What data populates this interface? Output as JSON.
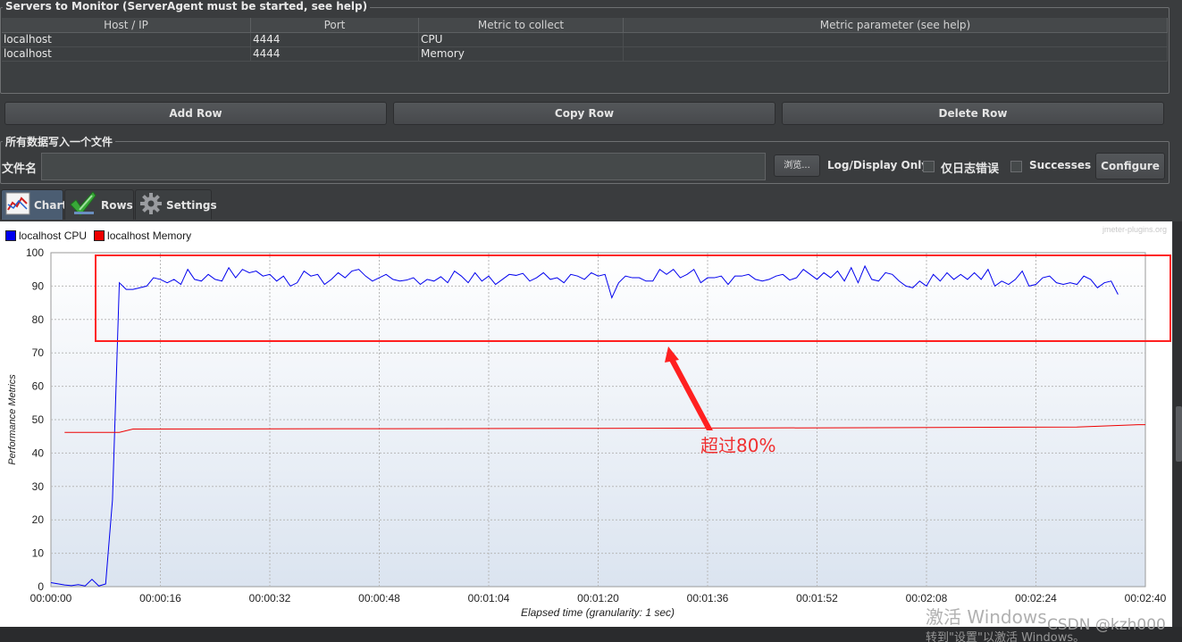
{
  "servers": {
    "title": "Servers to Monitor (ServerAgent must be started, see help)",
    "columns": [
      "Host / IP",
      "Port",
      "Metric to collect",
      "Metric parameter (see help)"
    ],
    "rows": [
      {
        "host": "localhost",
        "port": "4444",
        "metric": "CPU",
        "param": ""
      },
      {
        "host": "localhost",
        "port": "4444",
        "metric": "Memory",
        "param": ""
      }
    ],
    "add_row": "Add Row",
    "copy_row": "Copy Row",
    "delete_row": "Delete Row"
  },
  "file": {
    "group_title": "所有数据写入一个文件",
    "label": "文件名",
    "value": "",
    "browse": "浏览...",
    "log_display_only": "Log/Display Only:",
    "errors_only": "仅日志错误",
    "successes": "Successes",
    "configure": "Configure"
  },
  "tabs": [
    {
      "label": "Chart",
      "icon": "chart-icon",
      "active": true
    },
    {
      "label": "Rows",
      "icon": "checkmark-icon",
      "active": false
    },
    {
      "label": "Settings",
      "icon": "gear-icon",
      "active": false
    }
  ],
  "chart_branding": "jmeter-plugins.org",
  "chart_data": {
    "type": "line",
    "xlabel": "Elapsed time (granularity: 1 sec)",
    "ylabel": "Performance Metrics",
    "ylim": [
      0,
      100
    ],
    "xlim_seconds": [
      0,
      160
    ],
    "yticks": [
      0,
      10,
      20,
      30,
      40,
      50,
      60,
      70,
      80,
      90,
      100
    ],
    "xticks": [
      "00:00:00",
      "00:00:16",
      "00:00:32",
      "00:00:48",
      "00:01:04",
      "00:01:20",
      "00:01:36",
      "00:01:52",
      "00:02:08",
      "00:02:24",
      "00:02:40"
    ],
    "grid": true,
    "legend_position": "top-left",
    "series": [
      {
        "name": "localhost CPU",
        "color": "#0000ee",
        "values": [
          1.2,
          0.5,
          0.3,
          0.6,
          0.2,
          2.2,
          0.2,
          0.8,
          26,
          91,
          89,
          89,
          89.5,
          90,
          92.5,
          92,
          91,
          92,
          90.5,
          95,
          92,
          91.5,
          93.5,
          92,
          91.5,
          95.5,
          92.5,
          95,
          94,
          94.5,
          93,
          93.5,
          91.5,
          93,
          90,
          91,
          94.5,
          93,
          93.5,
          90.5,
          92,
          94,
          92.5,
          94.5,
          95,
          93,
          91.5,
          92.5,
          93.5,
          92,
          91.5,
          91.8,
          92.5,
          90.5,
          92,
          91.5,
          92.8,
          91,
          94.5,
          93,
          91,
          94,
          91.5,
          93,
          90.5,
          92,
          93.5,
          93.2,
          93.8,
          91.5,
          92.5,
          94,
          92,
          92.5,
          91,
          93.5,
          93,
          92,
          94,
          93,
          93.5,
          86.5,
          91,
          93,
          92.5,
          92.5,
          91.5,
          91.5,
          95,
          93.5,
          95,
          92.5,
          93.5,
          95,
          91,
          92.5,
          92.5,
          93,
          90.5,
          93,
          93,
          93.5,
          92,
          91.5,
          92,
          93,
          93.5,
          91.8,
          92.5,
          95,
          93.5,
          92,
          94,
          92.5,
          94.5,
          91.5,
          95.5,
          91,
          96,
          92,
          91.5,
          94,
          93.5,
          91.5,
          90,
          89.5,
          91.5,
          90,
          93.5,
          91.5,
          94,
          92,
          93.5,
          92,
          94,
          92,
          95,
          90,
          91.5,
          90.5,
          92,
          94.5,
          90,
          90.5,
          92.5,
          93,
          91,
          90.5,
          91,
          90.5,
          93,
          92,
          89.5,
          91,
          91.5,
          87.5
        ],
        "sample_times_seconds": [
          0,
          2,
          3,
          4,
          5,
          6,
          7,
          8,
          9,
          10,
          11,
          12,
          13,
          14,
          15,
          16,
          17,
          18,
          19,
          20,
          21,
          22,
          23,
          24,
          25,
          26,
          27,
          28,
          29,
          30,
          31,
          32,
          33,
          34,
          35,
          36,
          37,
          38,
          39,
          40,
          41,
          42,
          43,
          44,
          45,
          46,
          47,
          48,
          49,
          50,
          51,
          52,
          53,
          54,
          55,
          56,
          57,
          58,
          59,
          60,
          61,
          62,
          63,
          64,
          65,
          66,
          67,
          68,
          69,
          70,
          71,
          72,
          73,
          74,
          75,
          76,
          77,
          78,
          79,
          80,
          81,
          82,
          83,
          84,
          85,
          86,
          87,
          88,
          89,
          90,
          91,
          92,
          93,
          94,
          95,
          96,
          97,
          98,
          99,
          100,
          101,
          102,
          103,
          104,
          105,
          106,
          107,
          108,
          109,
          110,
          111,
          112,
          113,
          114,
          115,
          116,
          117,
          118,
          119,
          120,
          121,
          122,
          123,
          124,
          125,
          126,
          127,
          128,
          129,
          130,
          131,
          132,
          133,
          134,
          135,
          136,
          137,
          138,
          139,
          140,
          141,
          142,
          143,
          144,
          145,
          146,
          147,
          148,
          149,
          150,
          151,
          152,
          153,
          154,
          155,
          156,
          157,
          158,
          159,
          160
        ]
      },
      {
        "name": "localhost Memory",
        "color": "#ee0000",
        "points": [
          [
            2,
            46.2
          ],
          [
            10,
            46.2
          ],
          [
            12,
            47.2
          ],
          [
            50,
            47.3
          ],
          [
            80,
            47.4
          ],
          [
            120,
            47.6
          ],
          [
            150,
            47.8
          ],
          [
            159,
            48.5
          ],
          [
            160,
            48.5
          ]
        ]
      }
    ]
  },
  "annotation": {
    "text": "超过80%",
    "box_color": "#ff2020"
  },
  "watermarks": {
    "activate": "激活 Windows",
    "activate_hint": "转到\"设置\"以激活 Windows。",
    "csdn": "CSDN @kzh000"
  }
}
